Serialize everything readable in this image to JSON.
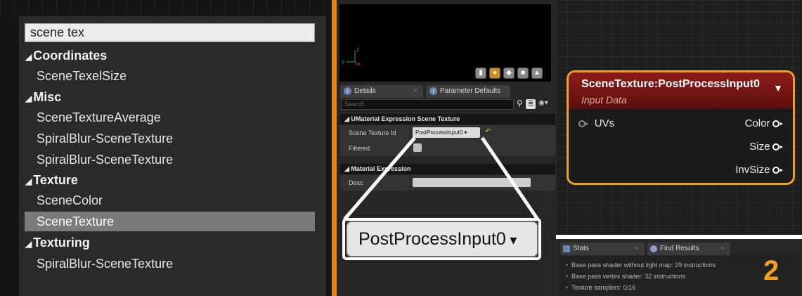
{
  "search_panel": {
    "query": "scene tex",
    "groups": [
      {
        "label": "Coordinates",
        "items": [
          "SceneTexelSize"
        ]
      },
      {
        "label": "Misc",
        "items": [
          "SceneTextureAverage",
          "SpiralBlur-SceneTexture",
          "SpiralBlur-SceneTexture"
        ]
      },
      {
        "label": "Texture",
        "items": [
          "SceneColor",
          "SceneTexture"
        ]
      },
      {
        "label": "Texturing",
        "items": [
          "SpiralBlur-SceneTexture"
        ]
      }
    ],
    "selected_item": "SceneTexture"
  },
  "viewport": {
    "axis_x": "x",
    "axis_y": "y",
    "axis_z": "z",
    "toolbar_icons": [
      "cylinder-icon",
      "sphere-icon",
      "plane-icon",
      "cube-icon",
      "mesh-icon"
    ]
  },
  "details": {
    "tabs": [
      {
        "label": "Details"
      },
      {
        "label": "Parameter Defaults"
      }
    ],
    "search_placeholder": "Search",
    "sections": [
      {
        "header": "UMaterial Expression Scene Texture",
        "properties": [
          {
            "label": "Scene Texture Id",
            "value": "PostProcessInput0"
          },
          {
            "label": "Filtered",
            "checked": false
          }
        ]
      },
      {
        "header": "Material Expression",
        "properties": [
          {
            "label": "Desc",
            "value": ""
          }
        ]
      }
    ],
    "callout_value": "PostProcessInput0"
  },
  "node": {
    "title": "SceneTexture:PostProcessInput0",
    "subtitle": "Input Data",
    "input_pins": [
      "UVs"
    ],
    "output_pins": [
      "Color",
      "Size",
      "InvSize"
    ]
  },
  "stats": {
    "tabs": [
      {
        "label": "Stats"
      },
      {
        "label": "Find Results"
      }
    ],
    "lines": [
      "Base pass shader without light map: 29 instructions",
      "Base pass vertex shader: 32 instructions",
      "Texture samplers: 0/16"
    ],
    "annotation_number": "2"
  },
  "colors": {
    "accent_orange": "#e0871a",
    "node_border": "#f0a21c",
    "node_header": "#8e1b1b",
    "selection": "#7a7a7a"
  }
}
